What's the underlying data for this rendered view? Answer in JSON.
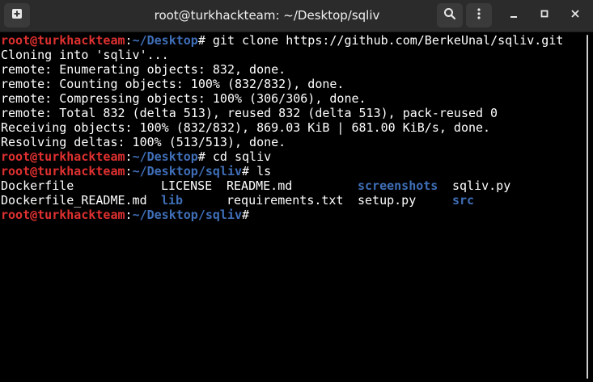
{
  "window": {
    "title": "root@turkhackteam: ~/Desktop/sqliv"
  },
  "icons": {
    "new_tab": "new-tab-icon",
    "search": "search-icon",
    "menu": "kebab-menu-icon",
    "minimize": "minimize-icon",
    "maximize": "maximize-icon",
    "close": "close-icon"
  },
  "colors": {
    "prompt_user": "#e03030",
    "prompt_path": "#3f6fb8",
    "directory": "#3f6fb8",
    "text": "#ffffff",
    "background": "#000000"
  },
  "prompt": {
    "user_host": "root@turkhackteam",
    "sep": ":",
    "suffix": "#"
  },
  "lines": {
    "l1": {
      "path": "~/Desktop",
      "cmd": " git clone https://github.com/BerkeUnal/sqliv.git"
    },
    "l2": "Cloning into 'sqliv'...",
    "l3": "remote: Enumerating objects: 832, done.",
    "l4": "remote: Counting objects: 100% (832/832), done.",
    "l5": "remote: Compressing objects: 100% (306/306), done.",
    "l6": "remote: Total 832 (delta 513), reused 832 (delta 513), pack-reused 0",
    "l7": "Receiving objects: 100% (832/832), 869.03 KiB | 681.00 KiB/s, done.",
    "l8": "Resolving deltas: 100% (513/513), done.",
    "l9": {
      "path": "~/Desktop",
      "cmd": " cd sqliv"
    },
    "l10": {
      "path": "~/Desktop/sqliv",
      "cmd": " ls"
    },
    "l13": {
      "path": "~/Desktop/sqliv",
      "cmd": ""
    }
  },
  "ls": {
    "row1": [
      {
        "name": "Dockerfile",
        "type": "file"
      },
      {
        "name": "LICENSE",
        "type": "file"
      },
      {
        "name": "README.md",
        "type": "file"
      },
      {
        "name": "screenshots",
        "type": "dir"
      },
      {
        "name": "sqliv.py",
        "type": "file"
      }
    ],
    "row2": [
      {
        "name": "Dockerfile_README.md",
        "type": "file"
      },
      {
        "name": "lib",
        "type": "dir"
      },
      {
        "name": "requirements.txt",
        "type": "file"
      },
      {
        "name": "setup.py",
        "type": "file"
      },
      {
        "name": "src",
        "type": "dir"
      }
    ]
  }
}
